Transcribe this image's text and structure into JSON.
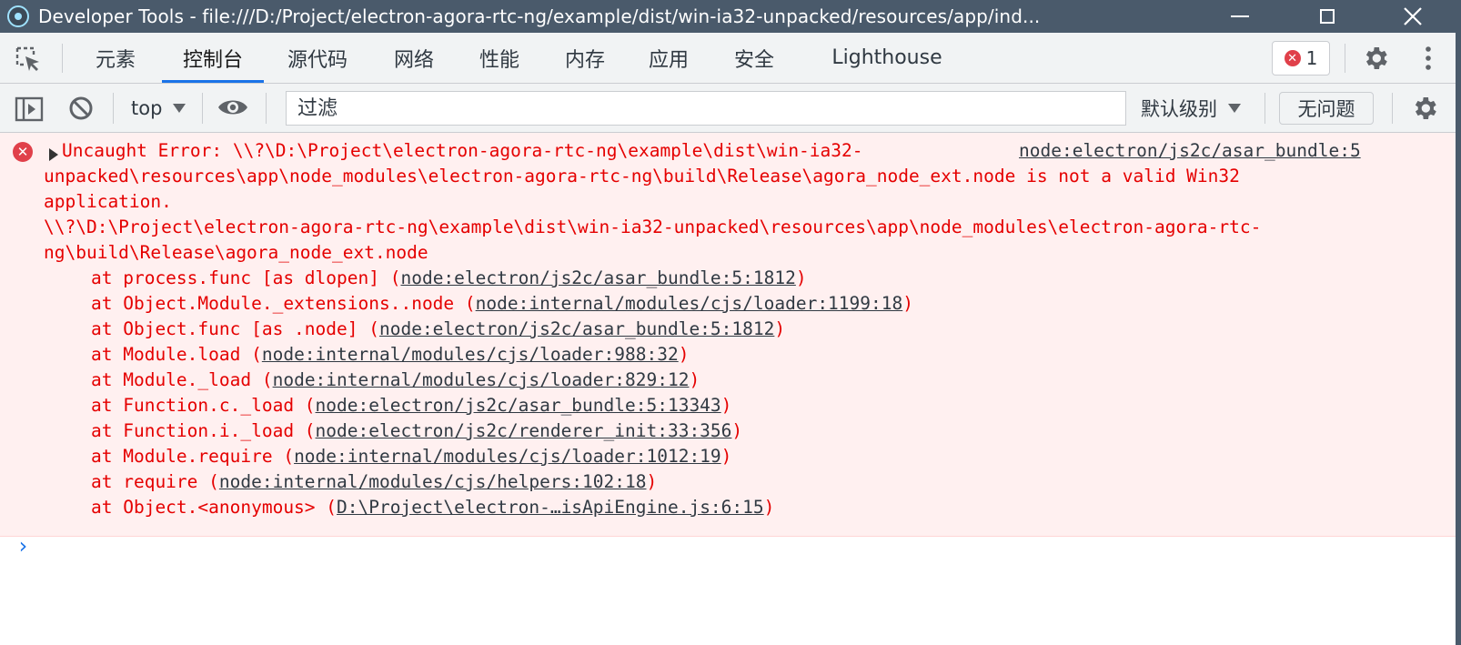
{
  "window": {
    "title": "Developer Tools - file:///D:/Project/electron-agora-rtc-ng/example/dist/win-ia32-unpacked/resources/app/ind..."
  },
  "tabs": [
    {
      "label": "元素"
    },
    {
      "label": "控制台",
      "active": true
    },
    {
      "label": "源代码"
    },
    {
      "label": "网络"
    },
    {
      "label": "性能"
    },
    {
      "label": "内存"
    },
    {
      "label": "应用"
    },
    {
      "label": "安全"
    },
    {
      "label": "Lighthouse"
    }
  ],
  "error_badge": {
    "count": "1",
    "color": "#e0404a"
  },
  "toolbar": {
    "context": "top",
    "filter_placeholder": "过滤",
    "level": "默认级别",
    "issues": "无问题"
  },
  "error": {
    "lines": [
      "Uncaught Error: \\\\?\\D:\\Project\\electron-agora-rtc-ng\\example\\dist\\win-ia32-",
      "unpacked\\resources\\app\\node_modules\\electron-agora-rtc-ng\\build\\Release\\agora_node_ext.node is not a valid Win32",
      "application.",
      "\\\\?\\D:\\Project\\electron-agora-rtc-ng\\example\\dist\\win-ia32-unpacked\\resources\\app\\node_modules\\electron-agora-rtc-",
      "ng\\build\\Release\\agora_node_ext.node"
    ],
    "source": "node:electron/js2c/asar_bundle:5",
    "stack": [
      {
        "fn": "at process.func [as dlopen] (",
        "loc": "node:electron/js2c/asar_bundle:5:1812"
      },
      {
        "fn": "at Object.Module._extensions..node (",
        "loc": "node:internal/modules/cjs/loader:1199:18"
      },
      {
        "fn": "at Object.func [as .node] (",
        "loc": "node:electron/js2c/asar_bundle:5:1812"
      },
      {
        "fn": "at Module.load (",
        "loc": "node:internal/modules/cjs/loader:988:32"
      },
      {
        "fn": "at Module._load (",
        "loc": "node:internal/modules/cjs/loader:829:12"
      },
      {
        "fn": "at Function.c._load (",
        "loc": "node:electron/js2c/asar_bundle:5:13343"
      },
      {
        "fn": "at Function.i._load (",
        "loc": "node:electron/js2c/renderer_init:33:356"
      },
      {
        "fn": "at Module.require (",
        "loc": "node:internal/modules/cjs/loader:1012:19"
      },
      {
        "fn": "at require (",
        "loc": "node:internal/modules/cjs/helpers:102:18"
      },
      {
        "fn": "at Object.<anonymous> (",
        "loc": "D:\\Project\\electron-…isApiEngine.js:6:15"
      }
    ],
    "close_paren": ")"
  },
  "prompt_symbol": "›",
  "colors": {
    "error_text": "#e50000",
    "error_bg": "#fff0f0",
    "accent": "#1a73e8",
    "titlebar": "#4a5a6b"
  }
}
